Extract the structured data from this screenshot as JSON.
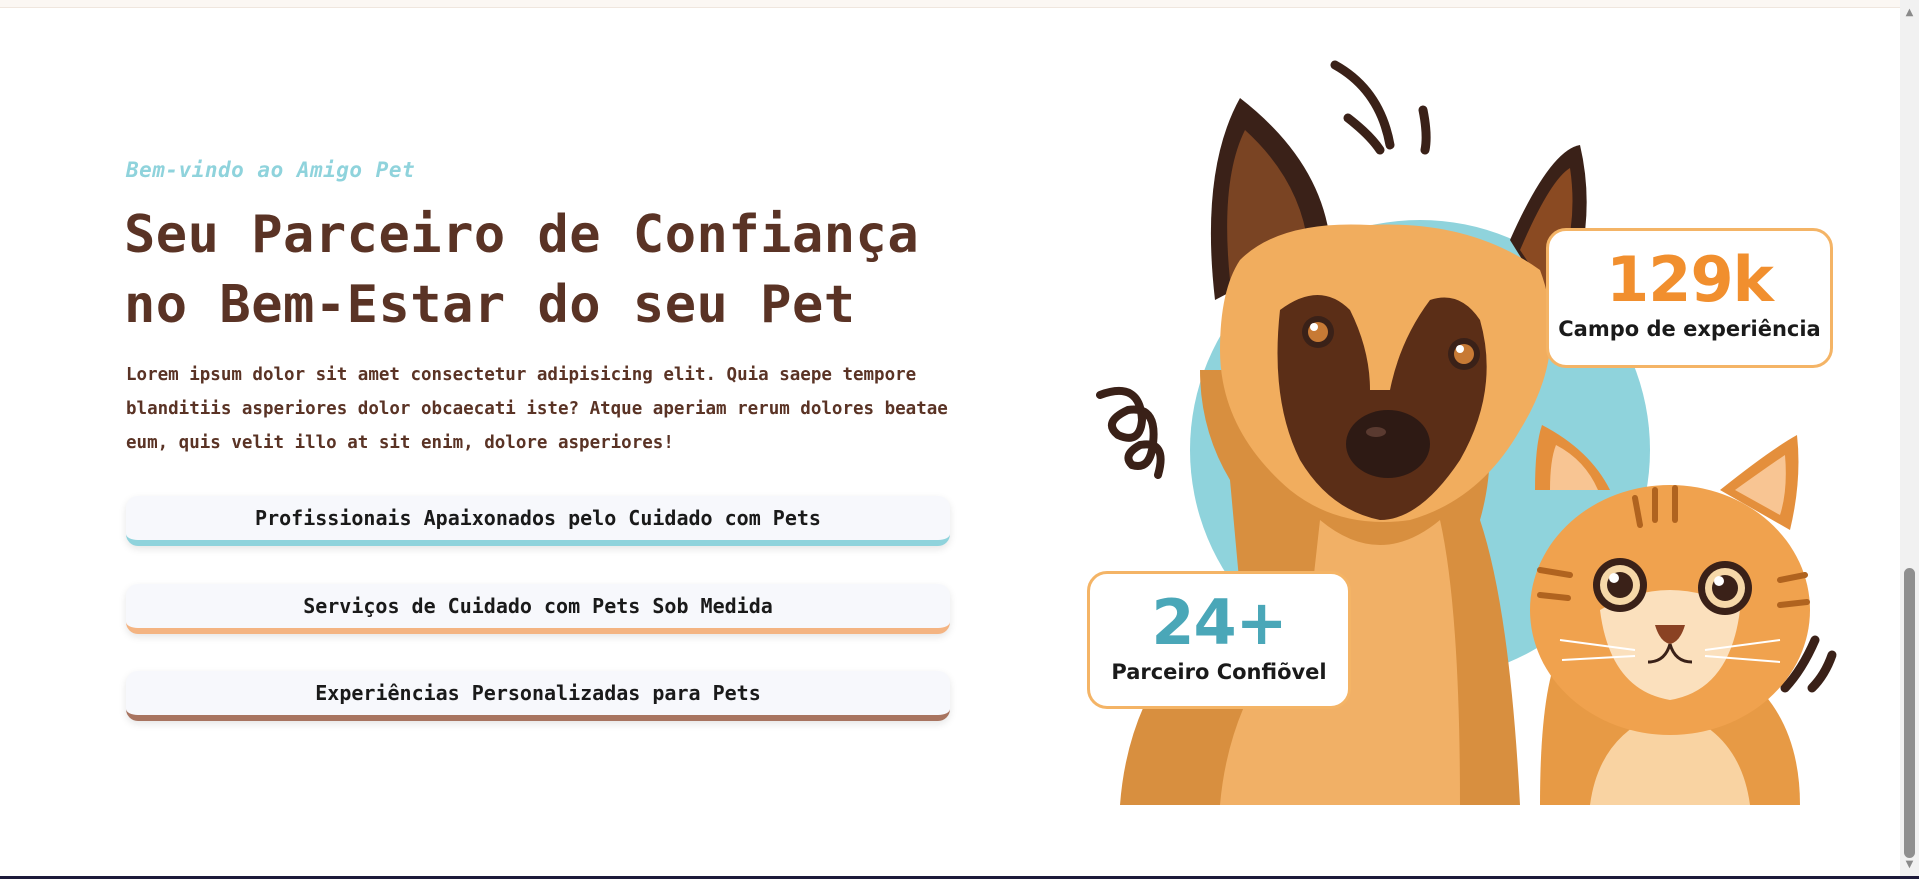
{
  "hero": {
    "welcome": "Bem-vindo ao Amigo Pet",
    "headline": "Seu Parceiro de Confiança no Bem-Estar do seu Pet",
    "lead": "Lorem ipsum dolor sit amet consectetur adipisicing elit. Quia saepe tempore blanditiis asperiores dolor obcaecati iste? Atque aperiam rerum dolores beatae eum, quis velit illo at sit enim, dolore asperiores!"
  },
  "features": [
    {
      "label": "Profissionais Apaixonados pelo Cuidado com Pets",
      "accent": "#8fd3dc"
    },
    {
      "label": "Serviços de Cuidado com Pets Sob Medida",
      "accent": "#f4b482"
    },
    {
      "label": "Experiências Personalizadas para Pets",
      "accent": "#a87460"
    }
  ],
  "stats": [
    {
      "value": "129k",
      "label": "Campo de experiência",
      "color": "#f18f2e"
    },
    {
      "value": "24+",
      "label": "Parceiro Confiõvel",
      "color": "#4aa7b8"
    }
  ],
  "illustration": {
    "subjects": [
      "dog",
      "cat"
    ],
    "backdrop_color": "#8fd3dc"
  },
  "colors": {
    "brand_brown": "#5a3325",
    "accent_teal": "#8fd3dc",
    "accent_orange": "#f4b466"
  }
}
